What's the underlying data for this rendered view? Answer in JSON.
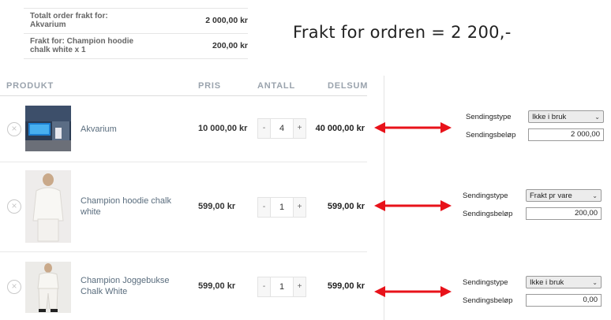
{
  "summary": {
    "rows": [
      {
        "label": "Totalt order frakt for: Akvarium",
        "value": "2 000,00 kr"
      },
      {
        "label": "Frakt for: Champion hoodie chalk white x 1",
        "value": "200,00 kr"
      }
    ]
  },
  "note": "Frakt for ordren = 2 200,-",
  "table": {
    "headers": {
      "product": "PRODUKT",
      "price": "PRIS",
      "quantity": "ANTALL",
      "subtotal": "DELSUM"
    }
  },
  "items": [
    {
      "name": "Akvarium",
      "price": "10 000,00 kr",
      "quantity": "4",
      "subtotal": "40 000,00 kr",
      "remove": "×",
      "minus": "-",
      "plus": "+"
    },
    {
      "name": "Champion hoodie chalk white",
      "price": "599,00 kr",
      "quantity": "1",
      "subtotal": "599,00 kr",
      "remove": "×",
      "minus": "-",
      "plus": "+"
    },
    {
      "name": "Champion Joggebukse Chalk White",
      "price": "599,00 kr",
      "quantity": "1",
      "subtotal": "599,00 kr",
      "remove": "×",
      "minus": "-",
      "plus": "+"
    }
  ],
  "shipping": [
    {
      "type_label": "Sendingstype",
      "type_value": "Ikke i bruk",
      "amount_label": "Sendingsbeløp",
      "amount_value": "2 000,00"
    },
    {
      "type_label": "Sendingstype",
      "type_value": "Frakt pr vare",
      "amount_label": "Sendingsbeløp",
      "amount_value": "200,00"
    },
    {
      "type_label": "Sendingstype",
      "type_value": "Ikke i bruk",
      "amount_label": "Sendingsbeløp",
      "amount_value": "0,00"
    }
  ],
  "colors": {
    "arrow": "#e8121a",
    "product_link": "#5a6d7e",
    "header_text": "#9aa3ad"
  },
  "icons": {
    "remove": "close-circle-icon",
    "select": "chevron-down-icon",
    "arrow": "double-arrow-icon"
  }
}
